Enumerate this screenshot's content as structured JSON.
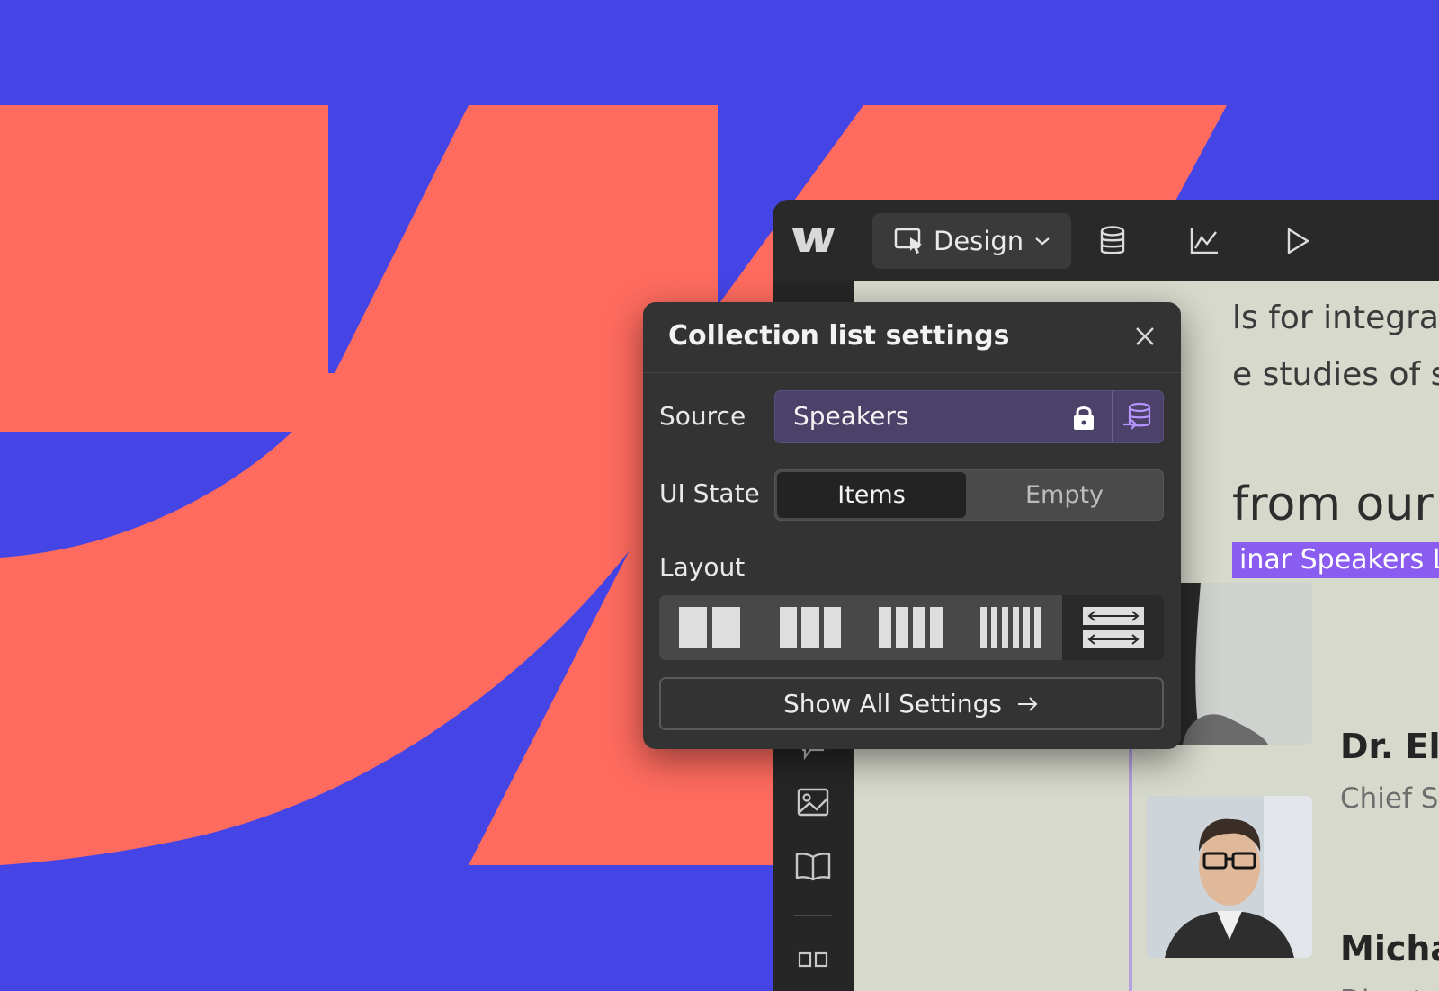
{
  "colors": {
    "background": "#4545e6",
    "brand_shape": "#ff6b5f",
    "accent_purple": "#8a5cf0",
    "source_field": "#4b4169"
  },
  "toolbar": {
    "logo_icon": "webflow-logo-icon",
    "mode_label": "Design",
    "icons": [
      "designer-cursor-icon",
      "chevron-down-icon",
      "database-icon",
      "analytics-chart-icon",
      "preview-play-icon"
    ]
  },
  "sidebar": {
    "icons": [
      "comment-icon",
      "image-icon",
      "book-icon",
      "components-icon"
    ]
  },
  "canvas": {
    "text_line_1": "ls for integrating",
    "text_line_2": "e studies of suc",
    "heading_fragment": "from our e",
    "collection_tag": "inar Speakers List",
    "speakers": [
      {
        "name": "Dr. Elena M",
        "role": "Chief Sustain"
      },
      {
        "name": "Michael Th",
        "role": "Director of Cli"
      }
    ]
  },
  "popover": {
    "title": "Collection list settings",
    "source_label": "Source",
    "source_value": "Speakers",
    "ui_state_label": "UI State",
    "ui_state_options": [
      "Items",
      "Empty"
    ],
    "ui_state_selected": "Items",
    "layout_label": "Layout",
    "layout_options": [
      "2-column-icon",
      "3-column-icon",
      "4-column-icon",
      "6-column-icon",
      "horizontal-scroll-icon"
    ],
    "layout_selected": "horizontal-scroll-icon",
    "show_all_label": "Show All Settings"
  }
}
